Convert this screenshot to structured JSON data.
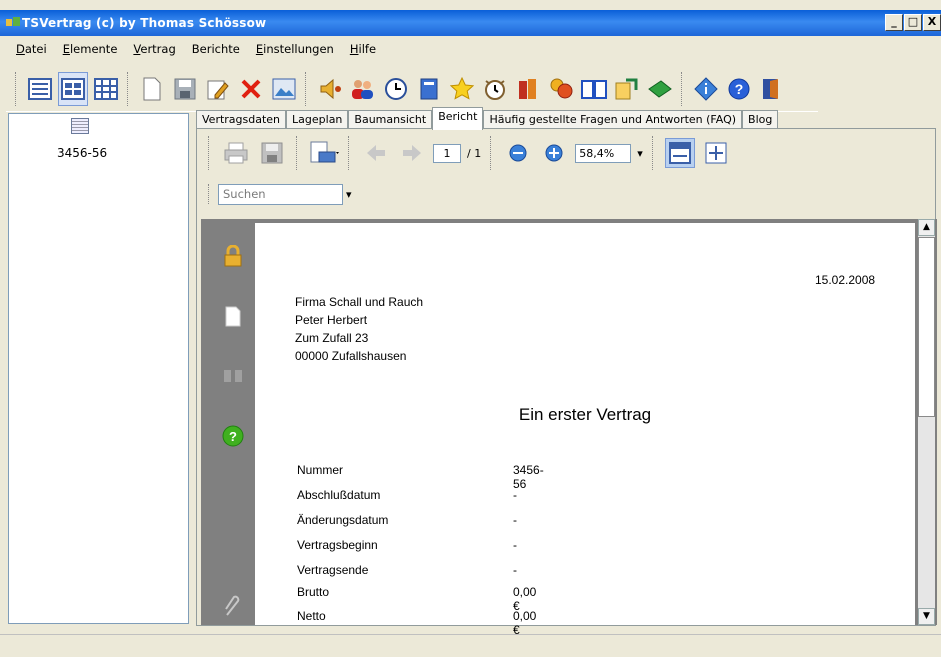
{
  "window": {
    "title": "TSVertrag (c) by Thomas Schössow",
    "min": "_",
    "max": "□",
    "close": "X"
  },
  "menu": [
    {
      "pre": "",
      "u": "D",
      "post": "atei"
    },
    {
      "pre": "",
      "u": "E",
      "post": "lemente"
    },
    {
      "pre": "",
      "u": "V",
      "post": "ertrag"
    },
    {
      "pre": "Berichte",
      "u": "",
      "post": ""
    },
    {
      "pre": "",
      "u": "E",
      "post": "instellungen"
    },
    {
      "pre": "",
      "u": "H",
      "post": "ilfe"
    }
  ],
  "toolbar_icons": [
    "list-view-icon",
    "tile-view-icon",
    "grid-view-icon",
    "new-document-icon",
    "save-icon",
    "edit-icon",
    "delete-icon",
    "image-icon",
    "speaker-icon",
    "users-icon",
    "clock-icon",
    "book-icon",
    "star-icon",
    "alarm-icon",
    "books-icon",
    "money-icon",
    "open-book-icon",
    "transfer-icon",
    "cash-icon",
    "info-icon",
    "help-icon",
    "exit-icon"
  ],
  "tree": {
    "item_label": "3456-56"
  },
  "tabs": [
    "Vertragsdaten",
    "Lageplan",
    "Baumansicht",
    "Bericht",
    "Häufig gestellte Fragen und Antworten (FAQ)",
    "Blog"
  ],
  "selected_tab": "Bericht",
  "report_toolbar": {
    "page_current": "1",
    "page_total": "/ 1",
    "zoom": "58,4%"
  },
  "search": {
    "placeholder": "Suchen"
  },
  "document": {
    "date": "15.02.2008",
    "address": [
      "Firma Schall und Rauch",
      "Peter Herbert",
      "Zum Zufall 23",
      "00000 Zufallshausen"
    ],
    "title": "Ein erster Vertrag",
    "fields": [
      {
        "label": "Nummer",
        "value": "3456-56"
      },
      {
        "label": "Abschlußdatum",
        "value": "-"
      },
      {
        "label": "Änderungsdatum",
        "value": "-"
      },
      {
        "label": "Vertragsbeginn",
        "value": "-"
      },
      {
        "label": "Vertragsende",
        "value": "-"
      },
      {
        "label": "Brutto",
        "value": "0,00 €"
      },
      {
        "label": "Netto",
        "value": "0,00 €"
      }
    ]
  }
}
